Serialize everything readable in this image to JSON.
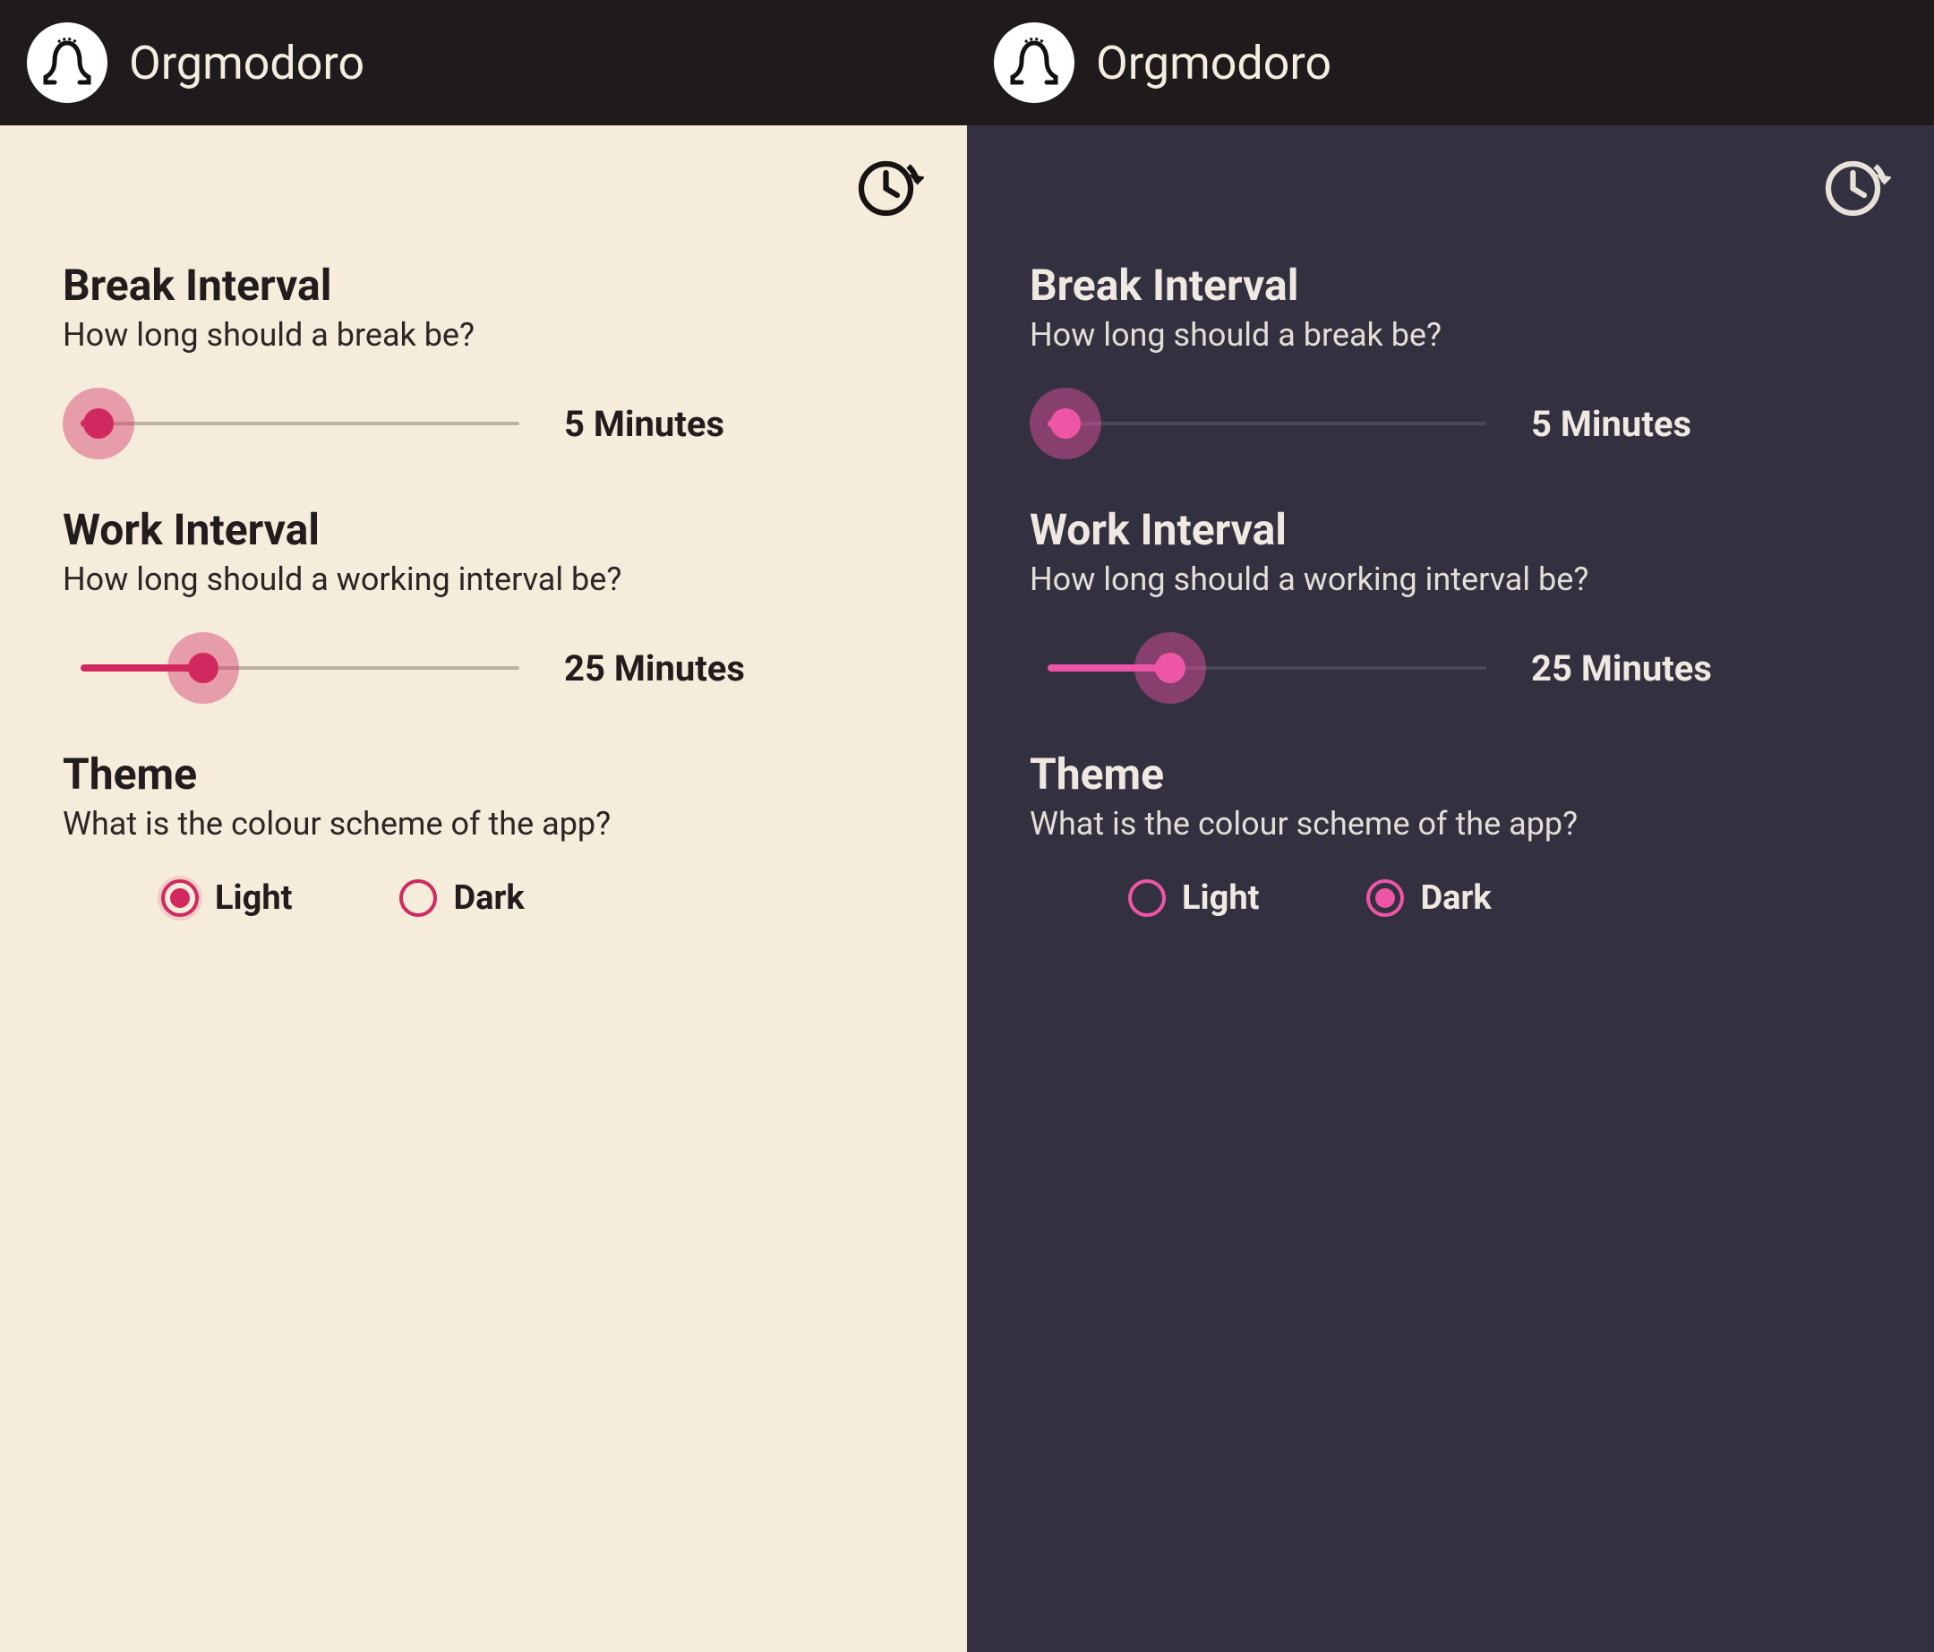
{
  "app": {
    "title": "Orgmodoro"
  },
  "sections": {
    "break": {
      "title": "Break Interval",
      "subtitle": "How long should a break be?",
      "value_label": "5 Minutes",
      "value": 5,
      "min": 1,
      "max": 60,
      "thumb_percent": 4
    },
    "work": {
      "title": "Work Interval",
      "subtitle": "How long should a working interval be?",
      "value_label": "25 Minutes",
      "value": 25,
      "min": 1,
      "max": 90,
      "thumb_percent": 28
    },
    "theme": {
      "title": "Theme",
      "subtitle": "What is the colour scheme of the app?",
      "options": {
        "light": "Light",
        "dark": "Dark"
      }
    }
  },
  "screens": {
    "light": {
      "selected_theme": "light"
    },
    "dark": {
      "selected_theme": "dark"
    }
  },
  "colors": {
    "light_bg": "#f5ecdb",
    "dark_bg": "#33303f",
    "appbar_bg": "#1f1a1b",
    "accent_light": "#d22860",
    "accent_dark": "#ee55a6"
  }
}
